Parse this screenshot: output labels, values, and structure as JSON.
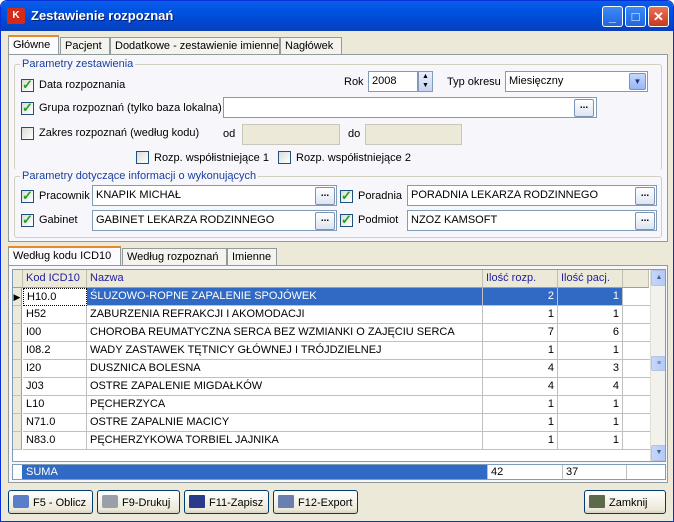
{
  "window": {
    "title": "Zestawienie rozpoznań",
    "icon": "app-logo-icon"
  },
  "top_tabs": [
    "Główne",
    "Pacjent",
    "Dodatkowe - zestawienie imienne",
    "Nagłówek"
  ],
  "params": {
    "group_label": "Parametry zestawienia",
    "data_rozpoznania": {
      "label": "Data rozpoznania",
      "checked": true
    },
    "rok": {
      "label": "Rok",
      "value": "2008"
    },
    "typ_okresu": {
      "label": "Typ okresu",
      "value": "Miesięczny"
    },
    "grupa": {
      "label": "Grupa rozpoznań  (tylko baza lokalna)",
      "checked": true,
      "value": ""
    },
    "zakres": {
      "label": "Zakres rozpoznań (według kodu)",
      "checked": false,
      "od_label": "od",
      "do_label": "do",
      "od_value": "",
      "do_value": ""
    },
    "wspol1": {
      "label": "Rozp. współistniejące 1",
      "checked": false
    },
    "wspol2": {
      "label": "Rozp. współistniejące 2",
      "checked": false
    }
  },
  "wykonujacy": {
    "group_label": "Parametry dotyczące informacji o wykonujących",
    "pracownik": {
      "label": "Pracownik",
      "checked": true,
      "value": "KNAPIK MICHAŁ"
    },
    "poradnia": {
      "label": "Poradnia",
      "checked": true,
      "value": "PORADNIA LEKARZA RODZINNEGO"
    },
    "gabinet": {
      "label": "Gabinet",
      "checked": true,
      "value": "GABINET LEKARZA RODZINNEGO"
    },
    "podmiot": {
      "label": "Podmiot",
      "checked": true,
      "value": "NZOZ KAMSOFT"
    }
  },
  "dots_label": "...",
  "bottom_tabs": [
    "Według kodu ICD10",
    "Według rozpoznań",
    "Imienne"
  ],
  "table": {
    "headers": [
      "Kod ICD10",
      "Nazwa",
      "Ilość rozp.",
      "Ilość pacj."
    ],
    "rows": [
      [
        "H10.0",
        "ŚLUZOWO-ROPNE ZAPALENIE SPOJÓWEK",
        "2",
        "1"
      ],
      [
        "H52",
        "ZABURZENIA REFRAKCJI I AKOMODACJI",
        "1",
        "1"
      ],
      [
        "I00",
        "CHOROBA REUMATYCZNA SERCA BEZ WZMIANKI O ZAJĘCIU SERCA",
        "7",
        "6"
      ],
      [
        "I08.2",
        "WADY ZASTAWEK TĘTNICY GŁÓWNEJ I TRÓJDZIELNEJ",
        "1",
        "1"
      ],
      [
        "I20",
        "DUSZNICA BOLESNA",
        "4",
        "3"
      ],
      [
        "J03",
        "OSTRE ZAPALENIE MIGDAŁKÓW",
        "4",
        "4"
      ],
      [
        "L10",
        "PĘCHERZYCA",
        "1",
        "1"
      ],
      [
        "N71.0",
        "OSTRE ZAPALNIE MACICY",
        "1",
        "1"
      ],
      [
        "N83.0",
        "PĘCHERZYKOWA TORBIEL JAJNIKA",
        "1",
        "1"
      ]
    ],
    "selected_row": 0,
    "sum": {
      "label": "SUMA",
      "rozp": "42",
      "pacj": "37"
    }
  },
  "buttons": {
    "oblicz": "F5 - Oblicz",
    "drukuj": "F9-Drukuj",
    "zapisz": "F11-Zapisz",
    "export": "F12-Export",
    "zamknij": "Zamknij"
  },
  "colors": {
    "title_bar": "#0054e3",
    "selection": "#316ac5",
    "sum_bar": "#316ac5",
    "tab_highlight": "#e68b2c"
  }
}
